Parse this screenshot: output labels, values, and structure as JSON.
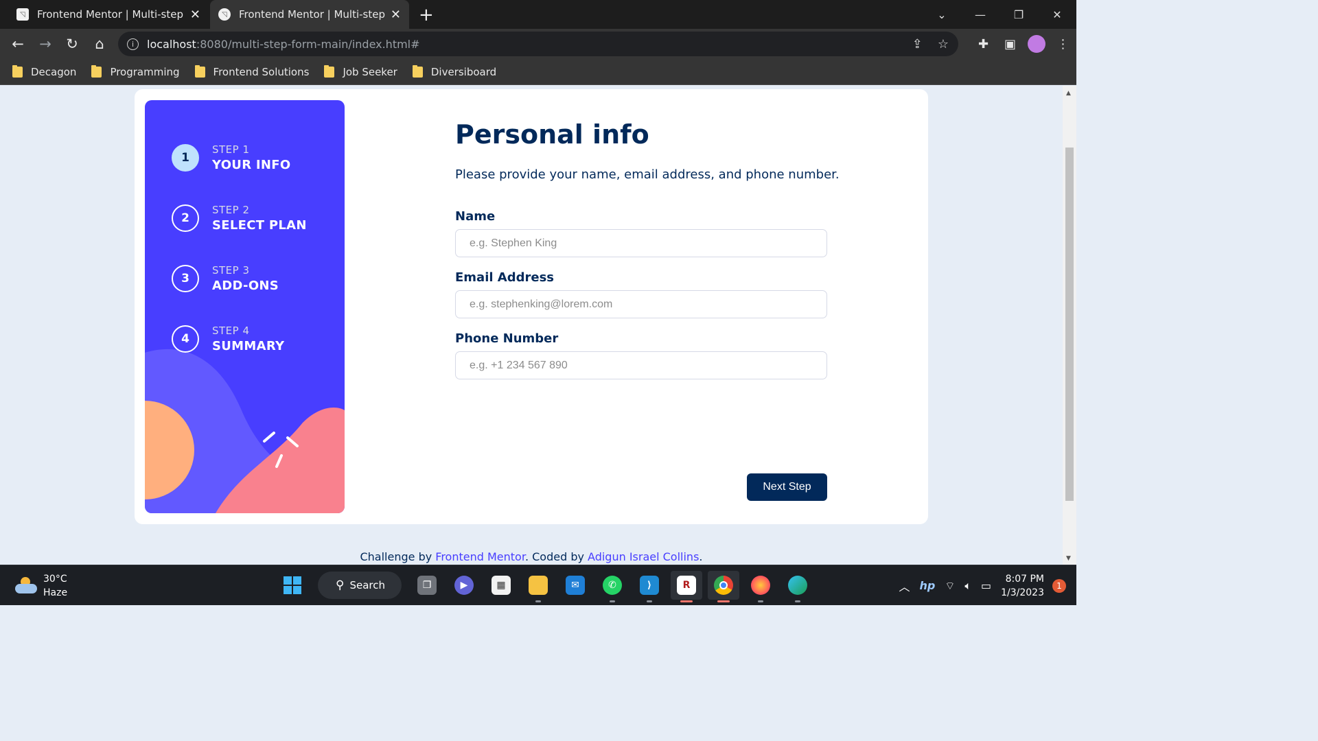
{
  "browser": {
    "tabs": [
      {
        "title": "Frontend Mentor | Multi-step form",
        "active": false
      },
      {
        "title": "Frontend Mentor | Multi-step form",
        "active": true
      }
    ],
    "new_tab_icon": "plus-icon",
    "url_host": "localhost",
    "url_rest": ":8080/multi-step-form-main/index.html#",
    "bookmarks": [
      "Decagon",
      "Programming",
      "Frontend Solutions",
      "Job Seeker",
      "Diversiboard"
    ]
  },
  "sidebar": {
    "steps": [
      {
        "number": "1",
        "label": "STEP 1",
        "name": "YOUR INFO",
        "active": true
      },
      {
        "number": "2",
        "label": "STEP 2",
        "name": "SELECT PLAN",
        "active": false
      },
      {
        "number": "3",
        "label": "STEP 3",
        "name": "ADD-ONS",
        "active": false
      },
      {
        "number": "4",
        "label": "STEP 4",
        "name": "SUMMARY",
        "active": false
      }
    ]
  },
  "form": {
    "title": "Personal info",
    "subtitle": "Please provide your name, email address, and phone number.",
    "fields": [
      {
        "label": "Name",
        "placeholder": "e.g. Stephen King",
        "value": ""
      },
      {
        "label": "Email Address",
        "placeholder": "e.g. stephenking@lorem.com",
        "value": ""
      },
      {
        "label": "Phone Number",
        "placeholder": "e.g. +1 234 567 890",
        "value": ""
      }
    ],
    "next_label": "Next Step"
  },
  "footer": {
    "prefix": "Challenge by ",
    "link1": "Frontend Mentor",
    "middle": ". Coded by ",
    "link2": "Adigun Israel Collins",
    "suffix": "."
  },
  "taskbar": {
    "weather_temp": "30°C",
    "weather_desc": "Haze",
    "search_label": "Search",
    "time": "8:07 PM",
    "date": "1/3/2023",
    "notifications": "1"
  },
  "colors": {
    "marine_blue": "#02295a",
    "purplish_blue": "#483eff",
    "light_blue": "#bfe2fd",
    "page_bg": "#e6edf6"
  }
}
